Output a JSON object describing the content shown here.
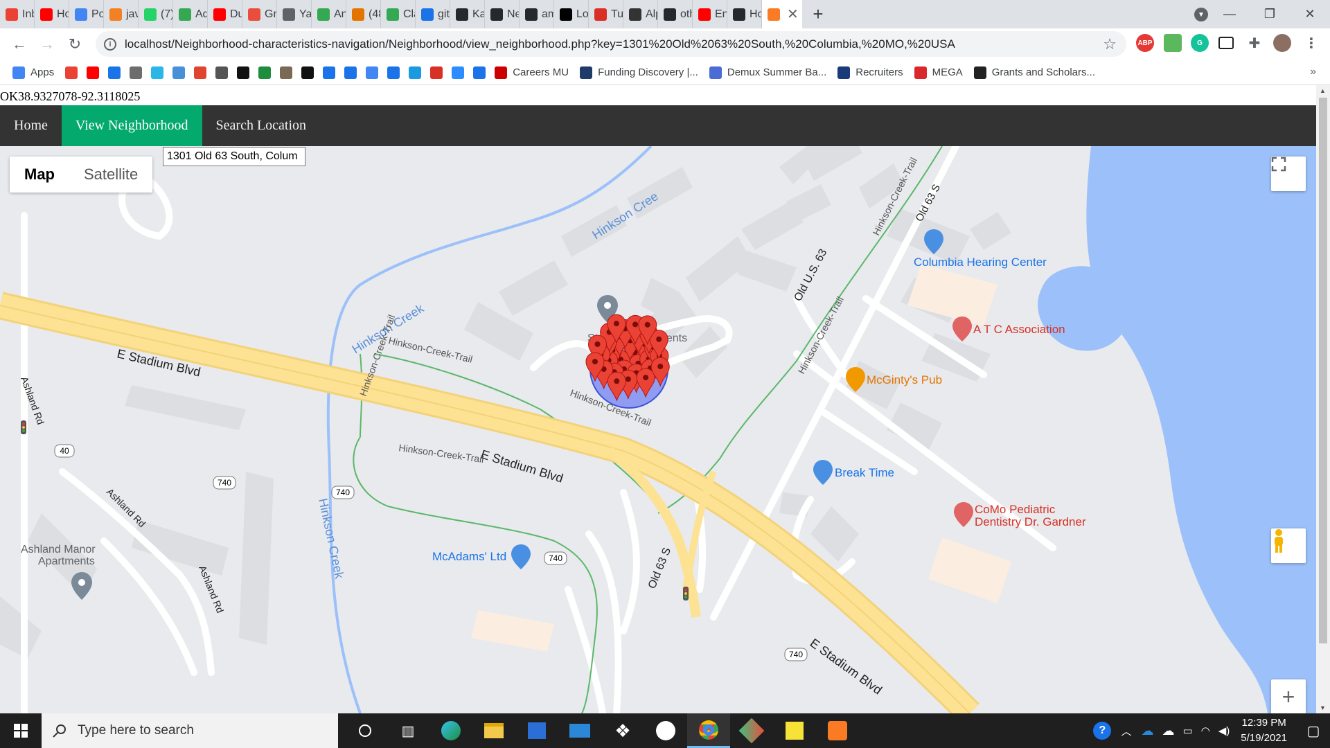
{
  "browser": {
    "tabs": [
      {
        "label": "Inb",
        "color": "#ea4335"
      },
      {
        "label": "Ho",
        "color": "#ff0000"
      },
      {
        "label": "Pol",
        "color": "#4285f4"
      },
      {
        "label": "jav",
        "color": "#f48024"
      },
      {
        "label": "(7)",
        "color": "#25d366"
      },
      {
        "label": "Ad",
        "color": "#34a853"
      },
      {
        "label": "Du",
        "color": "#ff0000"
      },
      {
        "label": "Gra",
        "color": "#e94e3c"
      },
      {
        "label": "Yav",
        "color": "#5f6368"
      },
      {
        "label": "An",
        "color": "#34a853"
      },
      {
        "label": "(48",
        "color": "#e37400"
      },
      {
        "label": "Cla",
        "color": "#34a853"
      },
      {
        "label": "git",
        "color": "#1a73e8"
      },
      {
        "label": "Ka",
        "color": "#24292e"
      },
      {
        "label": "Ne",
        "color": "#24292e"
      },
      {
        "label": "am",
        "color": "#24292e"
      },
      {
        "label": "Lol",
        "color": "#000000"
      },
      {
        "label": "Tu",
        "color": "#d93025"
      },
      {
        "label": "Alp",
        "color": "#333333"
      },
      {
        "label": "oth",
        "color": "#24292e"
      },
      {
        "label": "En",
        "color": "#ff0000"
      },
      {
        "label": "Ho",
        "color": "#24292e"
      }
    ],
    "active_tab": {
      "label": "",
      "color": "#fb7a24"
    },
    "url": "localhost/Neighborhood-characteristics-navigation/Neighborhood/view_neighborhood.php?key=1301%20Old%2063%20South,%20Columbia,%20MO,%20USA",
    "bookmarks": [
      {
        "label": "Apps",
        "color": "#4285f4"
      },
      {
        "label": "",
        "color": "#ea4335"
      },
      {
        "label": "",
        "color": "#ff0000"
      },
      {
        "label": "",
        "color": "#1a73e8"
      },
      {
        "label": "",
        "color": "#6d6d6d"
      },
      {
        "label": "",
        "color": "#2bb6e8"
      },
      {
        "label": "",
        "color": "#4a90d9"
      },
      {
        "label": "",
        "color": "#e0442f"
      },
      {
        "label": "",
        "color": "#555555"
      },
      {
        "label": "",
        "color": "#111111"
      },
      {
        "label": "",
        "color": "#1e8e3e"
      },
      {
        "label": "",
        "color": "#7a6a55"
      },
      {
        "label": "",
        "color": "#111111"
      },
      {
        "label": "",
        "color": "#1a73e8"
      },
      {
        "label": "",
        "color": "#1a73e8"
      },
      {
        "label": "",
        "color": "#4285f4"
      },
      {
        "label": "",
        "color": "#1a73e8"
      },
      {
        "label": "",
        "color": "#1a9ae0"
      },
      {
        "label": "",
        "color": "#d93025"
      },
      {
        "label": "",
        "color": "#2d8cff"
      },
      {
        "label": "",
        "color": "#1a73e8"
      },
      {
        "label": "Careers MU",
        "color": "#cc0000"
      },
      {
        "label": "Funding Discovery |...",
        "color": "#1f3b68"
      },
      {
        "label": "Demux Summer Ba...",
        "color": "#4a6cd4"
      },
      {
        "label": "Recruiters",
        "color": "#1a3a7a"
      },
      {
        "label": "MEGA",
        "color": "#d9272e"
      },
      {
        "label": "Grants and Scholars...",
        "color": "#222222"
      }
    ]
  },
  "page": {
    "coordinates_text": "OK38.9327078-92.3118025",
    "nav": [
      {
        "label": "Home"
      },
      {
        "label": "View Neighborhood"
      },
      {
        "label": "Search Location"
      }
    ],
    "address_value": "1301 Old 63 South, Colum",
    "map": {
      "map_type_buttons": [
        "Map",
        "Satellite"
      ],
      "labels": {
        "stadium_apartments": "Stadium Apartments",
        "columbia_hearing": "Columbia Hearing Center",
        "atc": "A T C Association",
        "mcgintys": "McGinty's Pub",
        "break_time": "Break Time",
        "como_pediatric_1": "CoMo Pediatric",
        "como_pediatric_2": "Dentistry Dr. Gardner",
        "mcadams": "McAdams' Ltd",
        "ashland_manor_1": "Ashland Manor",
        "ashland_manor_2": "Apartments",
        "e_stadium_1": "E Stadium Blvd",
        "e_stadium_2": "E Stadium Blvd",
        "e_stadium_3": "E Stadium Blvd",
        "hinkson_creek_1": "Hinkson Creek",
        "hinkson_creek_2": "Hinkson Cree",
        "hinkson_creek_3": "Hinkson Creek",
        "trail_1": "Hinkson-Creek-Trail",
        "trail_2": "Hinkson-Creek-Trail",
        "trail_3": "Hinkson-Creek-Trail",
        "trail_4": "Hinkson-Creek-Trail",
        "trail_5": "Hinkson-Creek-Trail",
        "trail_6": "Hinkson-Creek-Trail",
        "old_us_63": "Old U.S. 63",
        "old_63s_1": "Old 63 S",
        "old_63s_2": "Old 63 S",
        "ashland_rd_1": "Ashland Rd",
        "ashland_rd_2": "Ashland Rd",
        "ashland_rd_3": "Ashland Rd",
        "route_740": "740",
        "route_740b": "740",
        "route_740c": "740",
        "route_740d": "740",
        "route_40": "40"
      },
      "marker_count": 32
    }
  },
  "taskbar": {
    "search_placeholder": "Type here to search",
    "time": "12:39 PM",
    "date": "5/19/2021"
  }
}
